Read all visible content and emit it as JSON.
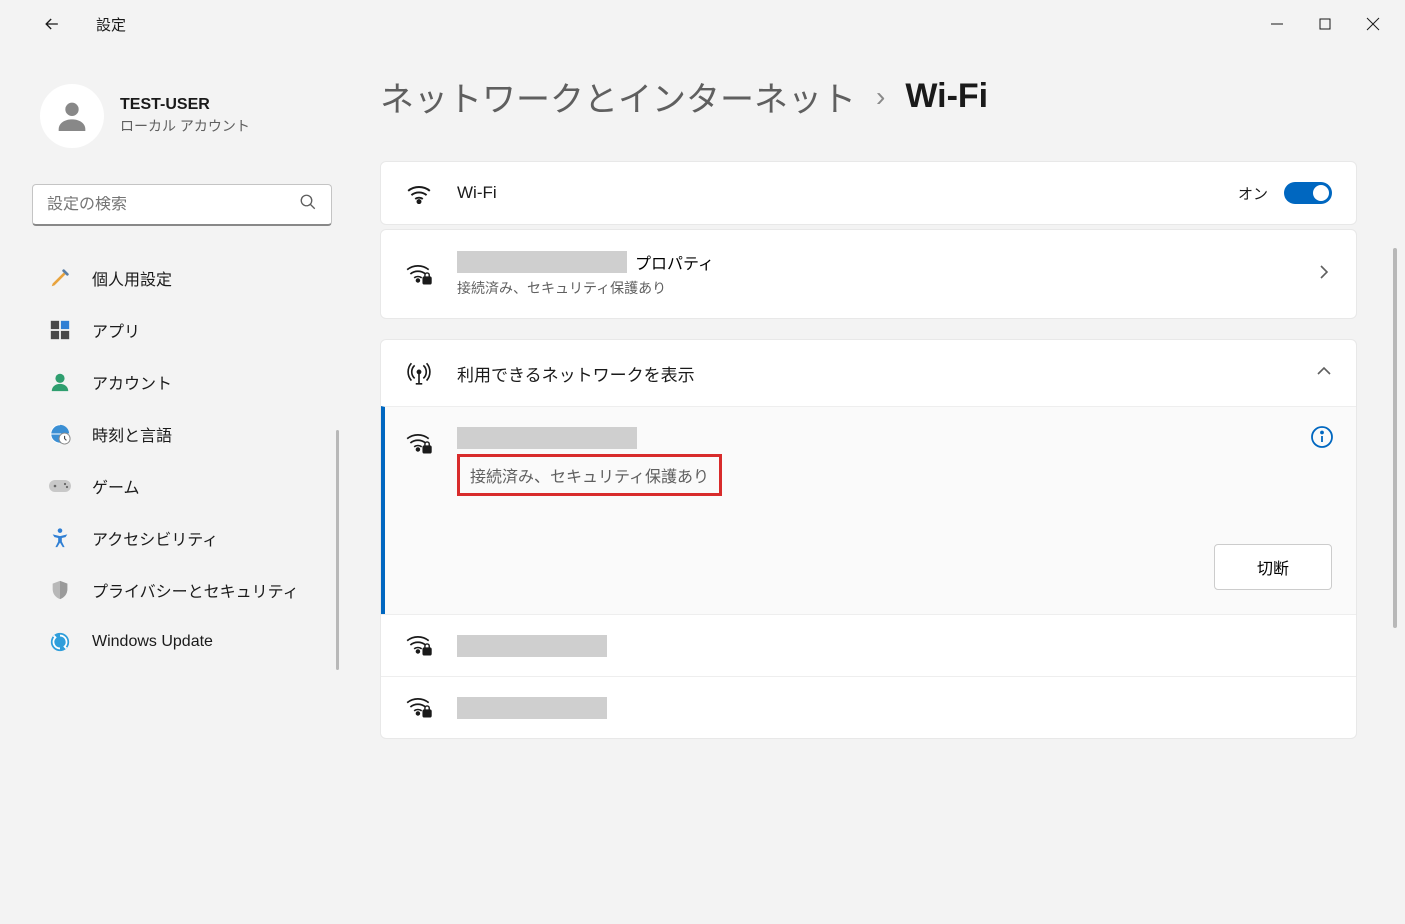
{
  "app_title": "設定",
  "user": {
    "name": "TEST-USER",
    "sub": "ローカル アカウント"
  },
  "search": {
    "placeholder": "設定の検索"
  },
  "sidebar": {
    "items": [
      {
        "label": "個人用設定"
      },
      {
        "label": "アプリ"
      },
      {
        "label": "アカウント"
      },
      {
        "label": "時刻と言語"
      },
      {
        "label": "ゲーム"
      },
      {
        "label": "アクセシビリティ"
      },
      {
        "label": "プライバシーとセキュリティ"
      },
      {
        "label": "Windows Update"
      }
    ]
  },
  "breadcrumb": {
    "parent": "ネットワークとインターネット",
    "current": "Wi-Fi"
  },
  "wifi_card": {
    "title": "Wi-Fi",
    "state_label": "オン"
  },
  "props_card": {
    "suffix": "プロパティ",
    "sub": "接続済み、セキュリティ保護あり"
  },
  "avail_card": {
    "title": "利用できるネットワークを表示"
  },
  "connected": {
    "status": "接続済み、セキュリティ保護あり",
    "disconnect": "切断"
  }
}
